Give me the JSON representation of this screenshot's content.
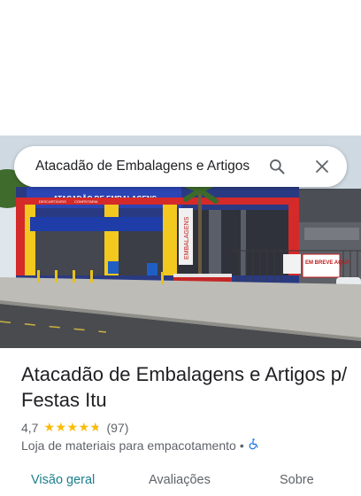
{
  "search": {
    "query": "Atacadão de Embalagens e Artigos p"
  },
  "place": {
    "title": "Atacadão de Embalagens e Artigos p/ Festas Itu",
    "rating": "4,7",
    "review_count": "(97)",
    "star_rating": 4.7,
    "category": "Loja de materiais para empacotamento",
    "separator": "•"
  },
  "photo": {
    "sign_top": "ATACADÃO DE EMBALAGENS",
    "sign_small": "DESCARTÁVEIS",
    "sign_small2": "CONFEITARIA",
    "side_sign": "EMBALAGENS",
    "banner": "EM BREVE AQUI!"
  },
  "tabs": [
    {
      "label": "Visão geral"
    },
    {
      "label": "Avaliações"
    },
    {
      "label": "Sobre"
    }
  ],
  "colors": {
    "star": "#fbbc04",
    "active_tab": "#1a7f8e",
    "accessibility_icon": "#1a73e8"
  },
  "icons": {
    "search": "search-icon",
    "close": "close-icon",
    "accessibility": "wheelchair-icon"
  }
}
